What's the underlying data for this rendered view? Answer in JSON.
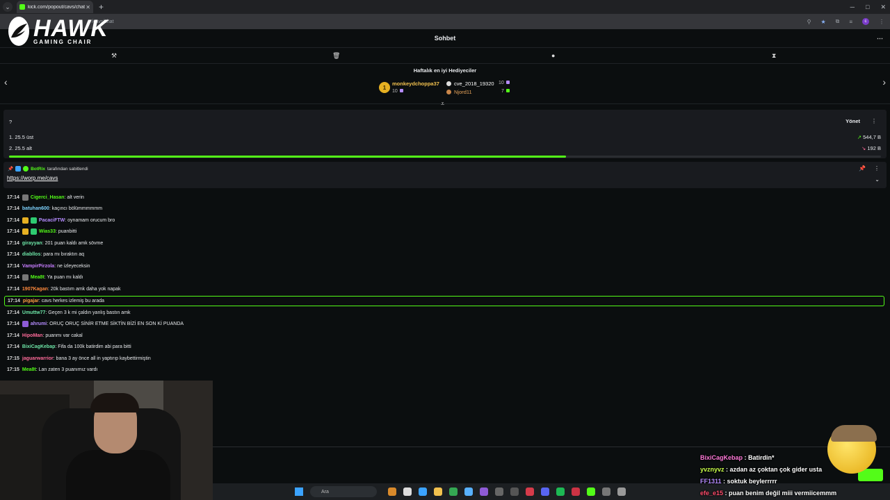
{
  "browser": {
    "tab_title": "kick.com/popout/cavs/chat",
    "url": "/cavs/chat",
    "profile_initial": "c"
  },
  "logo": {
    "brand": "HAWK",
    "tagline": "GAMING CHAIR"
  },
  "chat": {
    "title": "Sohbet",
    "gifters": {
      "title": "Haftalık en iyi Hediyeciler",
      "rank": "1",
      "top": [
        {
          "name": "monkeydchoppa37",
          "count": "10"
        },
        {
          "name": "cve_2018_19320",
          "count": "10"
        },
        {
          "name": "Njord11",
          "count": "7"
        }
      ]
    },
    "poll": {
      "question": "?",
      "manage_label": "Yönet",
      "options": [
        {
          "label": "1. 25.5 üst",
          "value": "544,7 B"
        },
        {
          "label": "2. 25.5 alt",
          "value": "192 B"
        }
      ],
      "progress": 0.639
    },
    "pinned": {
      "author": "BotRix",
      "action": "tarafından sabitlendi",
      "link": "https://worp.me/cavs"
    },
    "messages": [
      {
        "time": "17:14",
        "user": "Cigerci_Hasan",
        "color": "#53fc18",
        "text": ": alt verin"
      },
      {
        "time": "17:14",
        "user": "batuhan600",
        "color": "#7fd4ff",
        "text": ": kaçıncı bölümmmmmm"
      },
      {
        "time": "17:14",
        "user": "PacaciFTW",
        "color": "#b58cff",
        "text": ": oynamam orucum bro"
      },
      {
        "time": "17:14",
        "user": "Wias33",
        "color": "#53fc18",
        "text": ": puanbitti"
      },
      {
        "time": "17:14",
        "user": "girayyan",
        "color": "#6ee7a8",
        "text": ": 201 puan kaldı amk sövme"
      },
      {
        "time": "17:14",
        "user": "diabllos",
        "color": "#6ee7a8",
        "text": ": para mı bıraktın aq"
      },
      {
        "time": "17:14",
        "user": "VampirPirzola",
        "color": "#c77dff",
        "text": ": ne izleyeceksin"
      },
      {
        "time": "17:14",
        "user": "Mea8t",
        "color": "#53fc18",
        "text": ": Ya puan mı kaldı"
      },
      {
        "time": "17:14",
        "user": "1907Kagan",
        "color": "#ff8a3d",
        "text": ": 20k bastım amk daha yok napak"
      },
      {
        "time": "17:14",
        "user": "pigajar",
        "color": "#ff9f43",
        "text": ": cavs herkes izlemiş bu arada"
      },
      {
        "time": "17:14",
        "user": "Umuttw77",
        "color": "#6ee7a8",
        "text": ": Geçen 3 k mi çaldın yanlış bastın amk"
      },
      {
        "time": "17:14",
        "user": "ahrumi",
        "color": "#b58cff",
        "text": ": ORUÇ ORUÇ SİNİR ETME SİKTİN BİZİ EN SON Kİ PUANDA"
      },
      {
        "time": "17:14",
        "user": "HipoMan",
        "color": "#ff6b9a",
        "text": ": puanmı var cakal"
      },
      {
        "time": "17:14",
        "user": "BixiCagKebap",
        "color": "#6ee7a8",
        "text": ": Fifa da 100k batirdim abi para bitti"
      },
      {
        "time": "17:15",
        "user": "jaguarwarrior",
        "color": "#ff6b9a",
        "text": ": bana 3 ay önce all in yaptırıp kaybettirmiştin"
      },
      {
        "time": "17:15",
        "user": "Mea8t",
        "color": "#53fc18",
        "text": ": Lan zaten 3 puanımız vardı"
      }
    ]
  },
  "taskbar": {
    "search_placeholder": "Ara"
  },
  "overlay_chat": [
    {
      "user": "BixiCagKebap",
      "color": "#ff7ad9",
      "text": " : Batirdin*"
    },
    {
      "user": "yvznyvz",
      "color": "#c9ff4a",
      "text": " : azdan az çoktan çok gider usta"
    },
    {
      "user": "FF1311",
      "color": "#b58cff",
      "text": " : soktuk beylerrrrr"
    },
    {
      "user": "efe_e15",
      "color": "#ff4d6d",
      "text": " : puan benim değil miii vermiicemmm"
    }
  ]
}
